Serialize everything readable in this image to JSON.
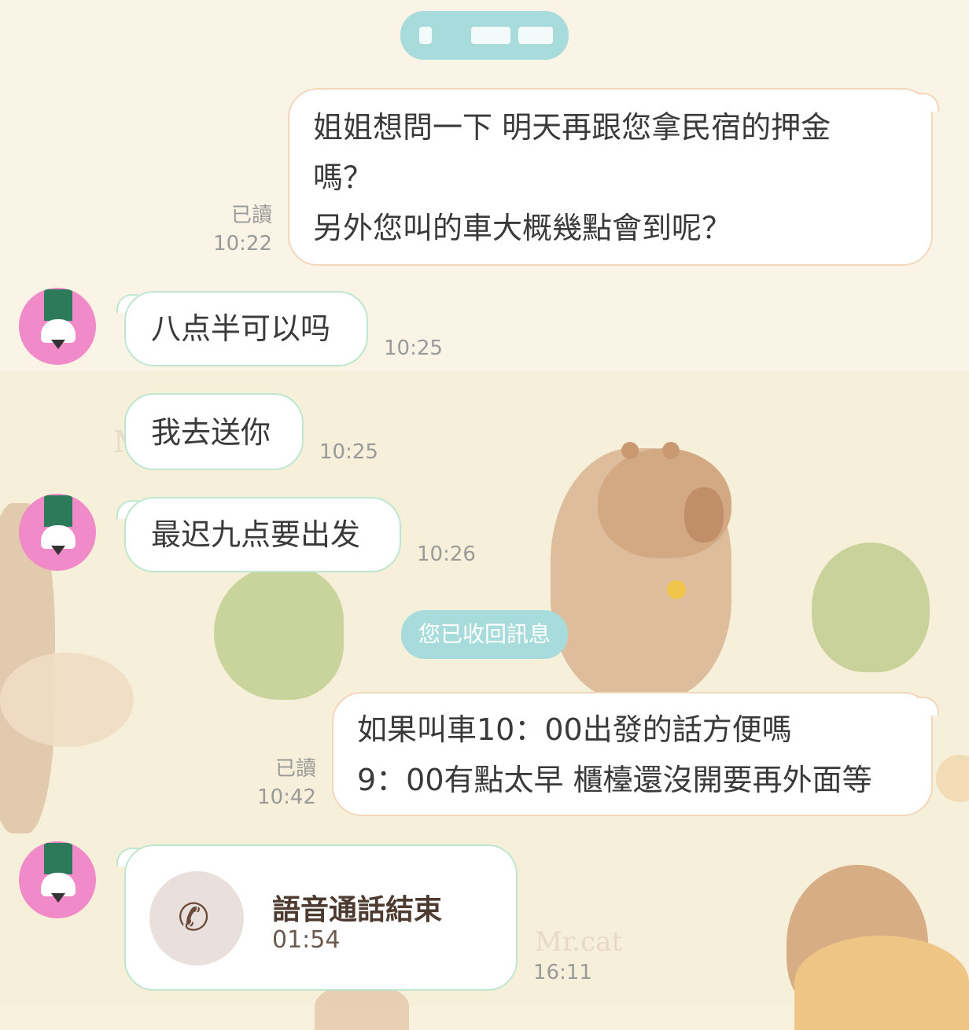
{
  "chat": {
    "messages": [
      {
        "side": "out",
        "lines": [
          "姐姐想問一下 明天再跟您拿民宿的押金",
          "嗎？",
          "另外您叫的車大概幾點會到呢？"
        ],
        "read": "已讀",
        "time": "10:22"
      },
      {
        "side": "in",
        "text": "八点半可以吗",
        "time": "10:25"
      },
      {
        "side": "in",
        "text": "我去送你",
        "time": "10:25"
      },
      {
        "side": "in",
        "text": "最迟九点要出发",
        "time": "10:26"
      },
      {
        "side": "system",
        "text": "您已收回訊息"
      },
      {
        "side": "out",
        "lines": [
          "如果叫車10：00出發的話方便嗎",
          "9：00有點太早 櫃檯還沒開要再外面等"
        ],
        "read": "已讀",
        "time": "10:42"
      },
      {
        "side": "in",
        "type": "call",
        "icon": "phone-icon",
        "title": "語音通話結束",
        "duration": "01:54",
        "time": "16:11"
      }
    ]
  },
  "background": {
    "sketch_text_1": "Mr.",
    "sketch_text_2": "Mr.cat"
  },
  "colors": {
    "out_border": "#f2d7bd",
    "in_border": "#bfe6cf",
    "system_pill": "#a8dcdc",
    "avatar": "#f08ac8"
  }
}
